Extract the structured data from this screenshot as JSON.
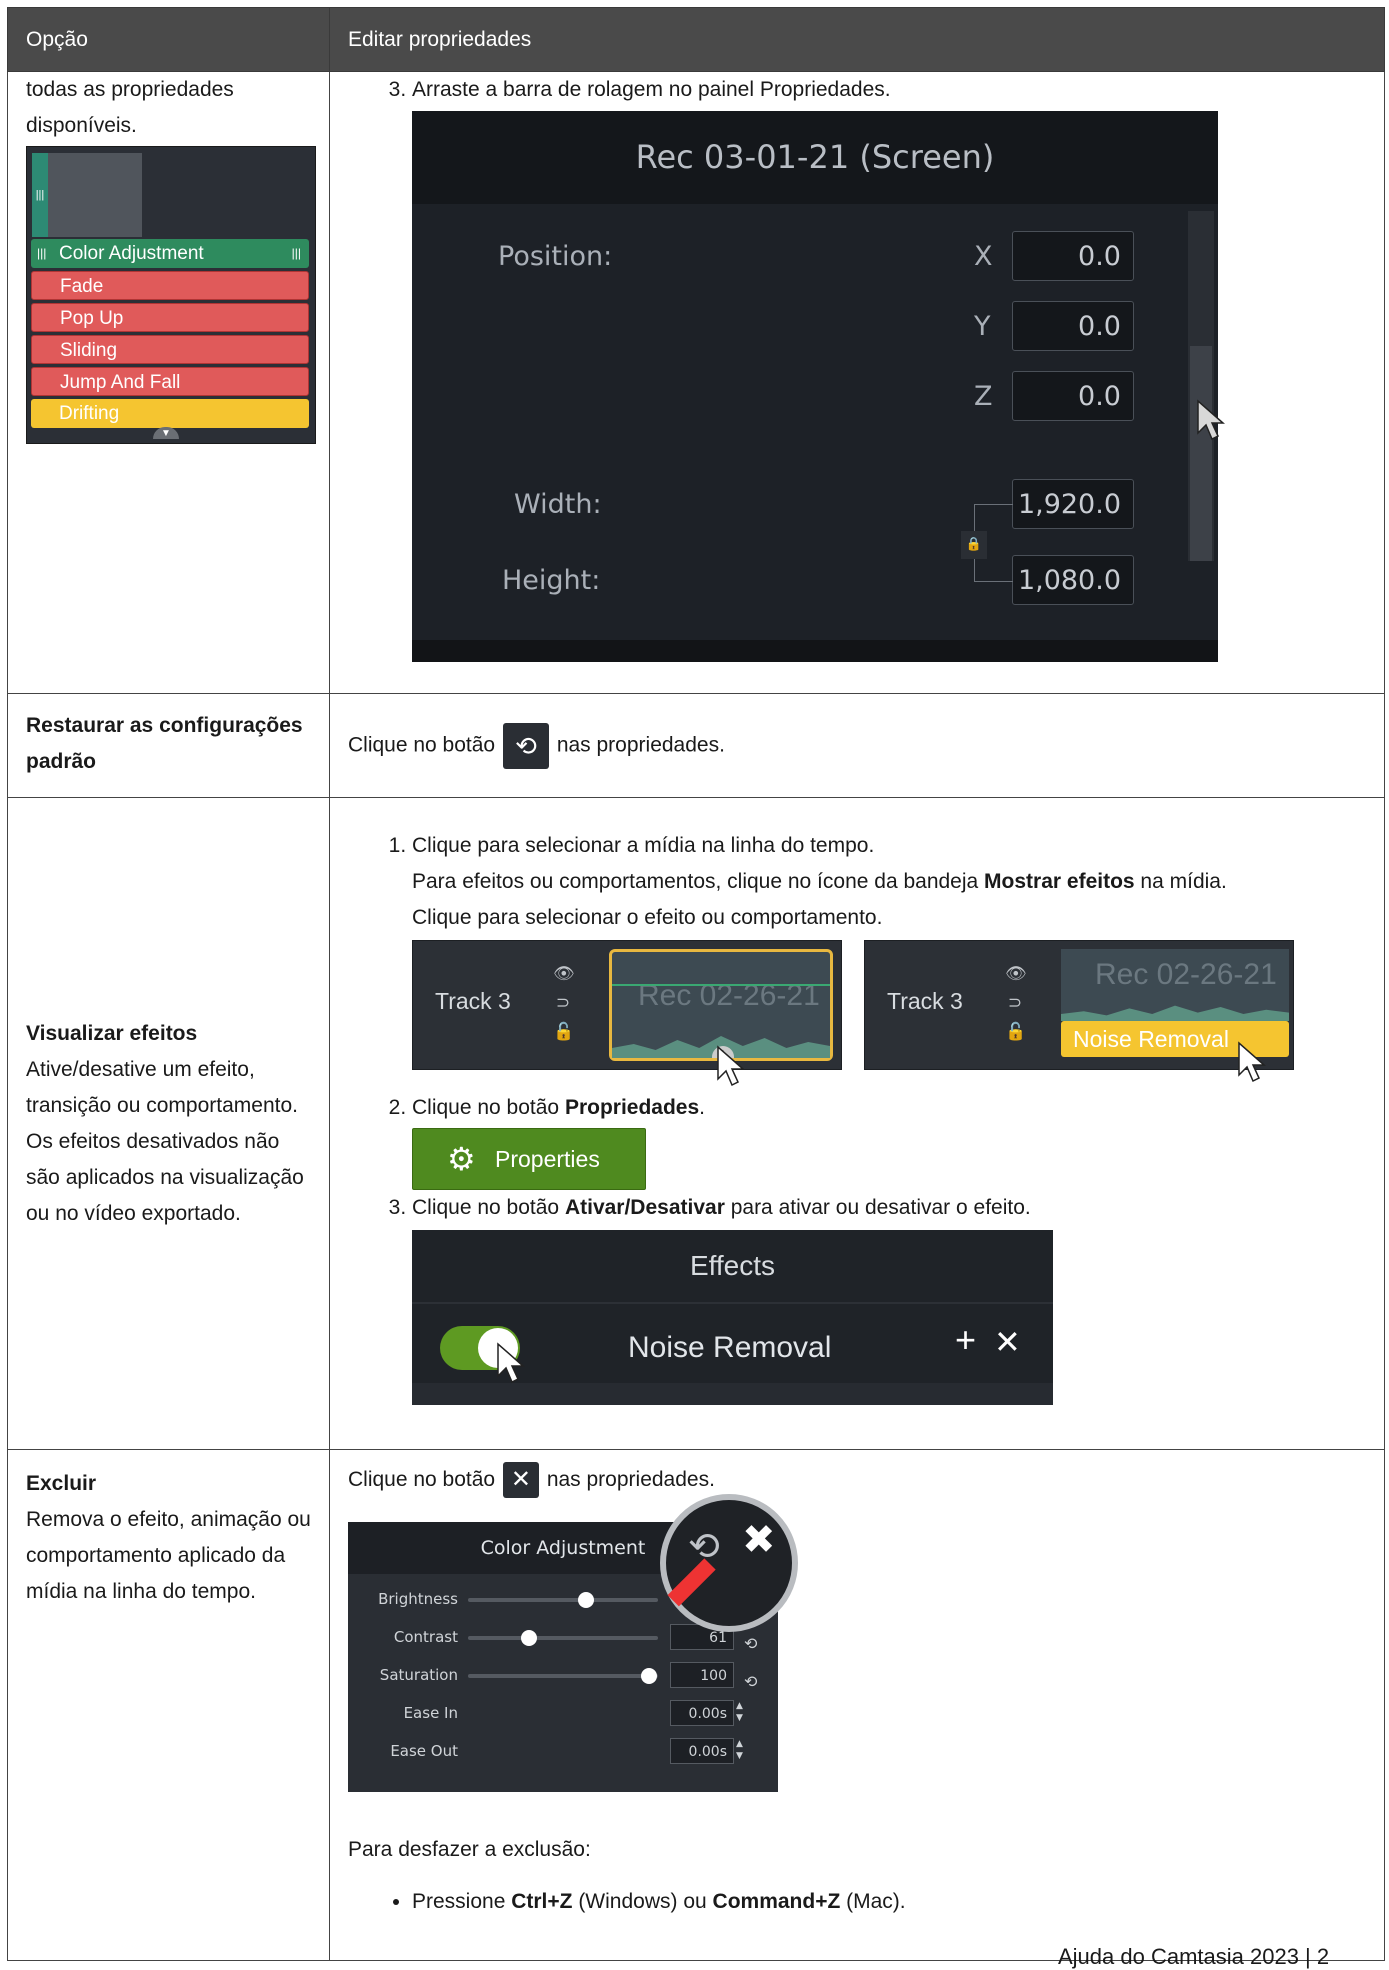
{
  "header": {
    "col1": "Opção",
    "col2": "Editar propriedades"
  },
  "row1": {
    "left_text": "todas as propriedades disponíveis.",
    "timeline_stack": {
      "items": [
        "Color Adjustment",
        "Fade",
        "Pop Up",
        "Sliding",
        "Jump And Fall",
        "Drifting"
      ]
    },
    "step3": "Arraste a barra de rolagem no painel Propriedades.",
    "props_panel": {
      "title": "Rec 03-01-21 (Screen)",
      "position_label": "Position:",
      "x_label": "X",
      "y_label": "Y",
      "z_label": "Z",
      "x_val": "0.0",
      "y_val": "0.0",
      "z_val": "0.0",
      "width_label": "Width:",
      "height_label": "Height:",
      "width_val": "1,920.0",
      "height_val": "1,080.0"
    }
  },
  "row2": {
    "title": "Restaurar as configurações padrão",
    "text_before": "Clique no botão",
    "text_after": "nas propriedades."
  },
  "row3": {
    "title": "Visualizar efeitos",
    "description": "Ative/desative um efeito, transição ou comportamento. Os efeitos desativados não são aplicados na visualização ou no vídeo exportado.",
    "step1_line1": "Clique para selecionar a mídia na linha do tempo.",
    "step1_line2_a": "Para efeitos ou comportamentos, clique no ícone da bandeja ",
    "step1_line2_b": "Mostrar efeitos",
    "step1_line2_c": " na mídia.",
    "step1_line3": "Clique para selecionar o efeito ou comportamento.",
    "track_label": "Track 3",
    "clip_label": "Rec 02-26-21",
    "noise_label": "Noise Removal",
    "step2_a": "Clique no botão ",
    "step2_b": "Propriedades",
    "step2_c": ".",
    "properties_button": "Properties",
    "step3_a": "Clique no botão ",
    "step3_b": "Ativar/Desativar",
    "step3_c": " para ativar ou desativar o efeito.",
    "effects_title": "Effects",
    "effect_name": "Noise Removal"
  },
  "row4": {
    "title": "Excluir",
    "description": "Remova o efeito, animação ou comportamento aplicado da mídia na linha do tempo.",
    "text_before": "Clique no botão",
    "text_after": "nas propriedades.",
    "color_adj": {
      "title": "Color Adjustment",
      "rows": [
        {
          "label": "Brightness",
          "value": "",
          "knob_pct": 0.62
        },
        {
          "label": "Contrast",
          "value": "61",
          "knob_pct": 0.32
        },
        {
          "label": "Saturation",
          "value": "100",
          "knob_pct": 0.95
        },
        {
          "label": "Ease In",
          "value": "0.00s"
        },
        {
          "label": "Ease Out",
          "value": "0.00s"
        }
      ]
    },
    "undo_label": "Para desfazer a exclusão:",
    "undo_a": "Pressione ",
    "undo_b": "Ctrl+Z",
    "undo_c": " (Windows) ou ",
    "undo_d": "Command+Z",
    "undo_e": " (Mac)."
  },
  "footer": "Ajuda do Camtasia 2023 | 2"
}
